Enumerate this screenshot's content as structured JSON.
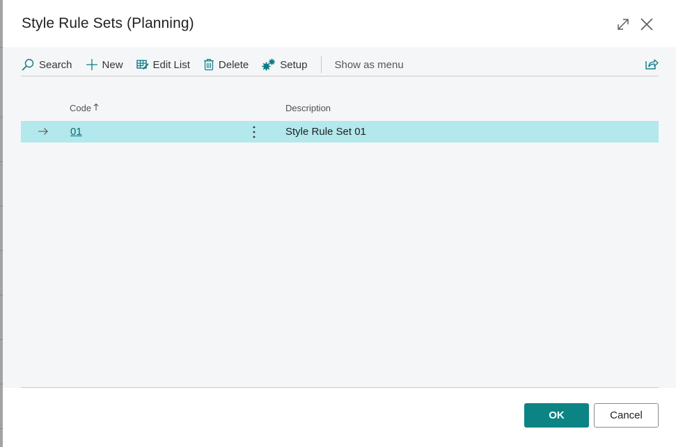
{
  "dialog": {
    "title": "Style Rule Sets (Planning)"
  },
  "toolbar": {
    "search_label": "Search",
    "new_label": "New",
    "edit_list_label": "Edit List",
    "delete_label": "Delete",
    "setup_label": "Setup",
    "show_as_menu_label": "Show as menu"
  },
  "table": {
    "columns": [
      {
        "label": "Code",
        "sorted": "ascending"
      },
      {
        "label": "Description"
      }
    ],
    "rows": [
      {
        "code": "01",
        "description": "Style Rule Set 01",
        "selected": true
      }
    ]
  },
  "footer": {
    "ok_label": "OK",
    "cancel_label": "Cancel"
  },
  "colors": {
    "accent": "#0c8484",
    "selected_row": "#b3e8ec",
    "link": "#0b6a73"
  }
}
